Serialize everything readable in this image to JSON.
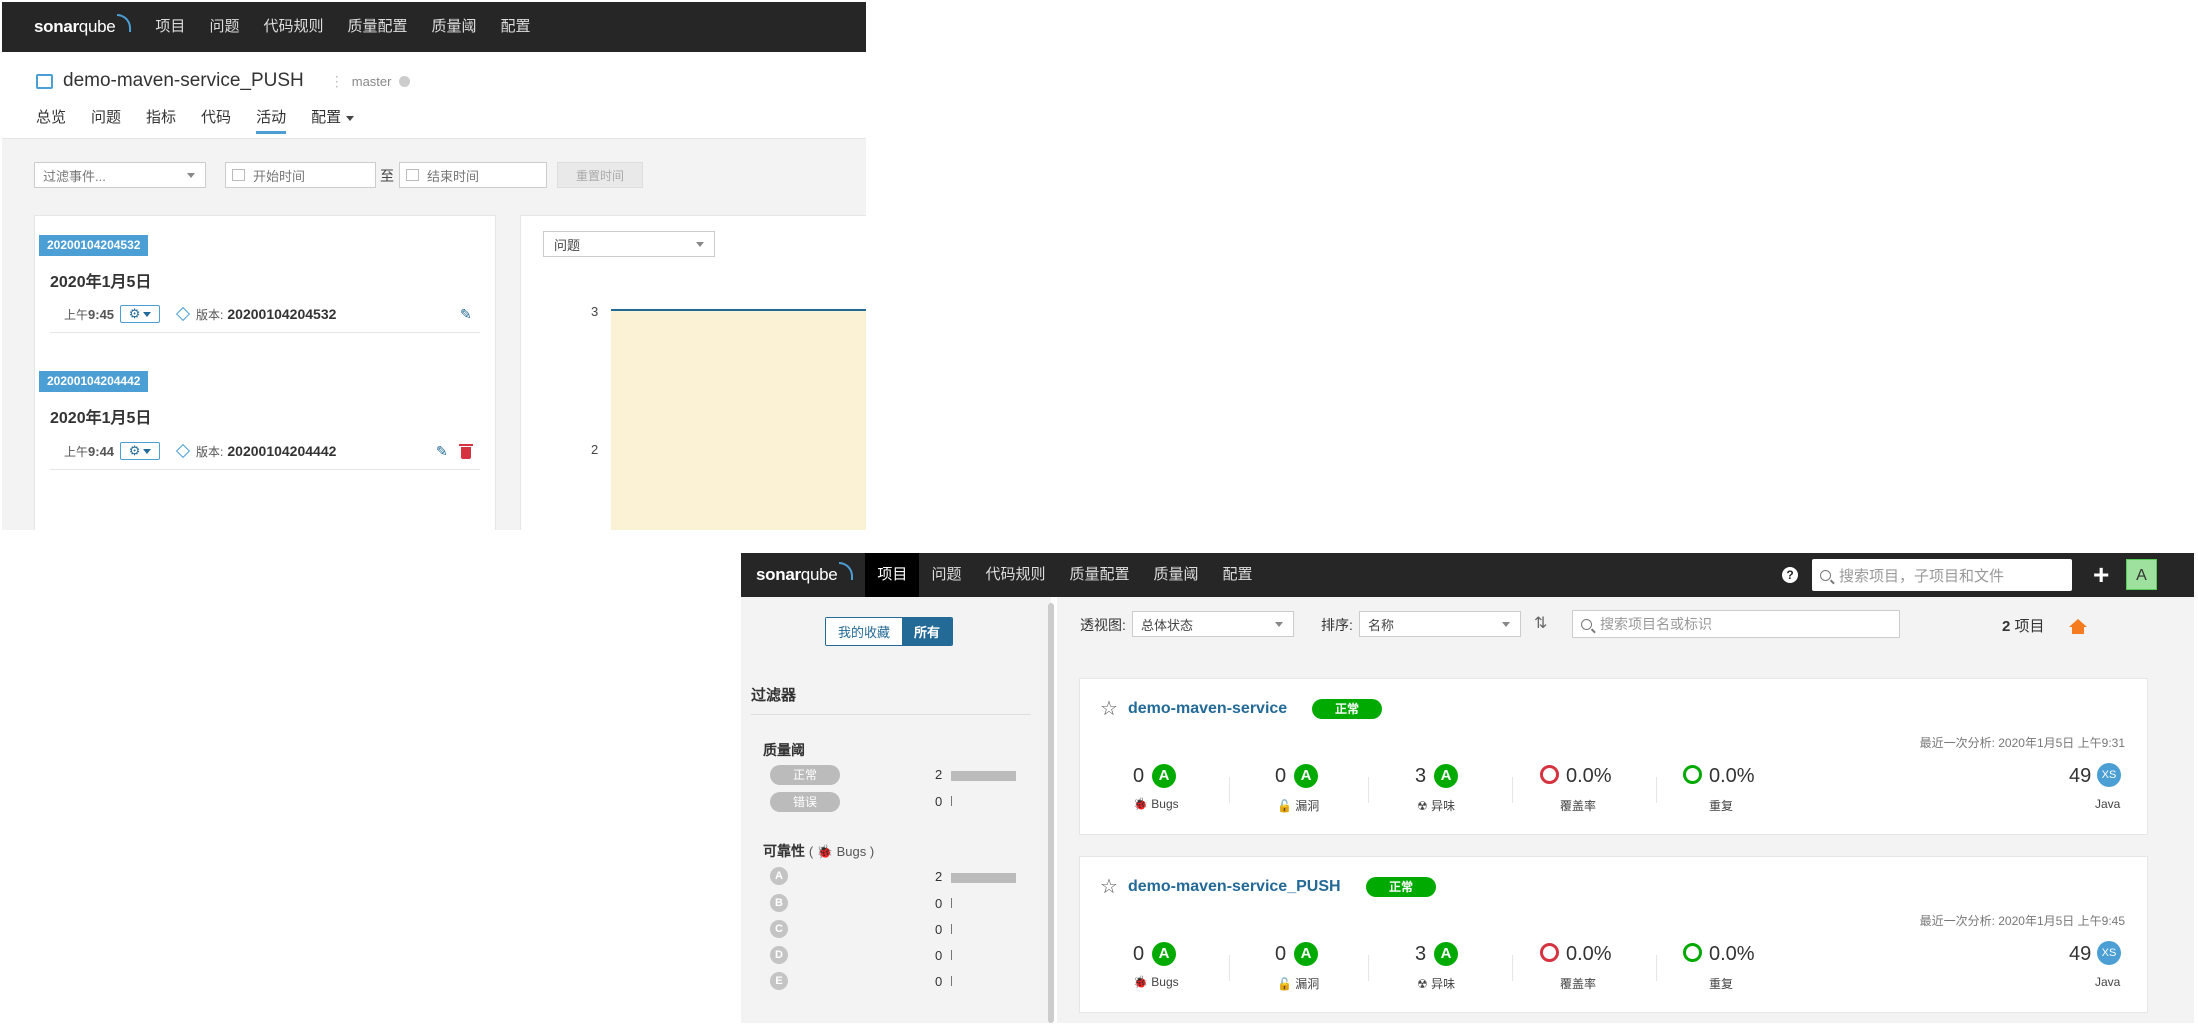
{
  "brand": {
    "part1": "sonar",
    "part2": "qube"
  },
  "p1": {
    "nav": [
      "项目",
      "问题",
      "代码规则",
      "质量配置",
      "质量阈",
      "配置"
    ],
    "project_title": "demo-maven-service_PUSH",
    "branch": "master",
    "tabs": [
      "总览",
      "问题",
      "指标",
      "代码",
      "活动",
      "配置"
    ],
    "filter_placeholder": "过滤事件...",
    "start_placeholder": "开始时间",
    "to_label": "至",
    "end_placeholder": "结束时间",
    "reset_label": "重置时间",
    "events": [
      {
        "version_badge": "20200104204532",
        "date": "2020年1月5日",
        "time_prefix": "上午",
        "time": "9:45",
        "version_label": "版本:",
        "version": "20200104204532"
      },
      {
        "version_badge": "20200104204442",
        "date": "2020年1月5日",
        "time_prefix": "上午",
        "time": "9:44",
        "version_label": "版本:",
        "version": "20200104204442"
      }
    ],
    "chart_select": "问题",
    "chart_ticks": [
      "3",
      "2"
    ]
  },
  "p2": {
    "nav": [
      "项目",
      "问题",
      "代码规则",
      "质量配置",
      "质量阈",
      "配置"
    ],
    "search_placeholder": "搜索项目，子项目和文件",
    "avatar": "A",
    "help": "?",
    "plus": "+",
    "toggle": {
      "favorites": "我的收藏",
      "all": "所有"
    },
    "filters_title": "过滤器",
    "quality_gate": {
      "title": "质量阈",
      "items": [
        {
          "label": "正常",
          "count": "2"
        },
        {
          "label": "错误",
          "count": "0"
        }
      ]
    },
    "reliability": {
      "title": "可靠性",
      "sub": "( 🐞 Bugs )",
      "items": [
        {
          "label": "A",
          "count": "2"
        },
        {
          "label": "B",
          "count": "0"
        },
        {
          "label": "C",
          "count": "0"
        },
        {
          "label": "D",
          "count": "0"
        },
        {
          "label": "E",
          "count": "0"
        }
      ]
    },
    "perspective_label": "透视图:",
    "perspective_value": "总体状态",
    "sort_label": "排序:",
    "sort_value": "名称",
    "project_search_placeholder": "搜索项目名或标识",
    "count_num": "2",
    "count_label": "项目",
    "projects": [
      {
        "name": "demo-maven-service",
        "gate": "正常",
        "last_analysis": "最近一次分析: 2020年1月5日 上午9:31",
        "bugs": "0",
        "bugs_rating": "A",
        "bugs_label": "Bugs",
        "vulns": "0",
        "vulns_rating": "A",
        "vulns_label": "漏洞",
        "smells": "3",
        "smells_rating": "A",
        "smells_label": "异味",
        "coverage": "0.0%",
        "coverage_label": "覆盖率",
        "dup": "0.0%",
        "dup_label": "重复",
        "size": "49",
        "size_rating": "XS",
        "lang": "Java"
      },
      {
        "name": "demo-maven-service_PUSH",
        "gate": "正常",
        "last_analysis": "最近一次分析: 2020年1月5日 上午9:45",
        "bugs": "0",
        "bugs_rating": "A",
        "bugs_label": "Bugs",
        "vulns": "0",
        "vulns_rating": "A",
        "vulns_label": "漏洞",
        "smells": "3",
        "smells_rating": "A",
        "smells_label": "异味",
        "coverage": "0.0%",
        "coverage_label": "覆盖率",
        "dup": "0.0%",
        "dup_label": "重复",
        "size": "49",
        "size_rating": "XS",
        "lang": "Java"
      }
    ]
  },
  "colors": {
    "accent": "#4b9fd5",
    "link": "#236a97",
    "ok": "#00aa00",
    "error": "#d4333f",
    "nav": "#262626",
    "home": "#f47b20"
  }
}
